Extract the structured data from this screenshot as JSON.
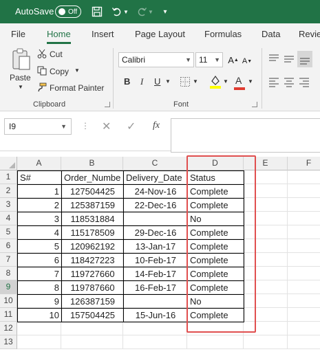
{
  "titlebar": {
    "autosave_label": "AutoSave",
    "toggle_state": "Off"
  },
  "tabs": [
    "File",
    "Home",
    "Insert",
    "Page Layout",
    "Formulas",
    "Data",
    "Revie"
  ],
  "ribbon": {
    "clipboard": {
      "paste": "Paste",
      "cut": "Cut",
      "copy": "Copy",
      "format_painter": "Format Painter",
      "label": "Clipboard"
    },
    "font": {
      "name": "Calibri",
      "size": "11",
      "bold": "B",
      "italic": "I",
      "underline": "U",
      "font_color_glyph": "A",
      "label": "Font",
      "font_color": "#e03c31",
      "fill_color": "#ffff00"
    }
  },
  "formula_bar": {
    "name_box": "I9",
    "fx": "fx",
    "value": ""
  },
  "sheet": {
    "columns": [
      "A",
      "B",
      "C",
      "D",
      "E",
      "F"
    ],
    "rows": [
      "1",
      "2",
      "3",
      "4",
      "5",
      "6",
      "7",
      "8",
      "9",
      "10",
      "11",
      "12",
      "13"
    ],
    "selected_row": "9",
    "headers": [
      "S#",
      "Order_Numbe",
      "Delivery_Date",
      "Status"
    ],
    "data": [
      [
        "1",
        "127504425",
        "24-Nov-16",
        "Complete"
      ],
      [
        "2",
        "125387159",
        "22-Dec-16",
        "Complete"
      ],
      [
        "3",
        "118531884",
        "",
        "No"
      ],
      [
        "4",
        "115178509",
        "29-Dec-16",
        "Complete"
      ],
      [
        "5",
        "120962192",
        "13-Jan-17",
        "Complete"
      ],
      [
        "6",
        "118427223",
        "10-Feb-17",
        "Complete"
      ],
      [
        "7",
        "119727660",
        "14-Feb-17",
        "Complete"
      ],
      [
        "8",
        "119787660",
        "16-Feb-17",
        "Complete"
      ],
      [
        "9",
        "126387159",
        "",
        "No"
      ],
      [
        "10",
        "157504425",
        "15-Jun-16",
        "Complete"
      ]
    ],
    "highlight_color": "#e04e4e"
  },
  "colors": {
    "brand": "#217346"
  }
}
